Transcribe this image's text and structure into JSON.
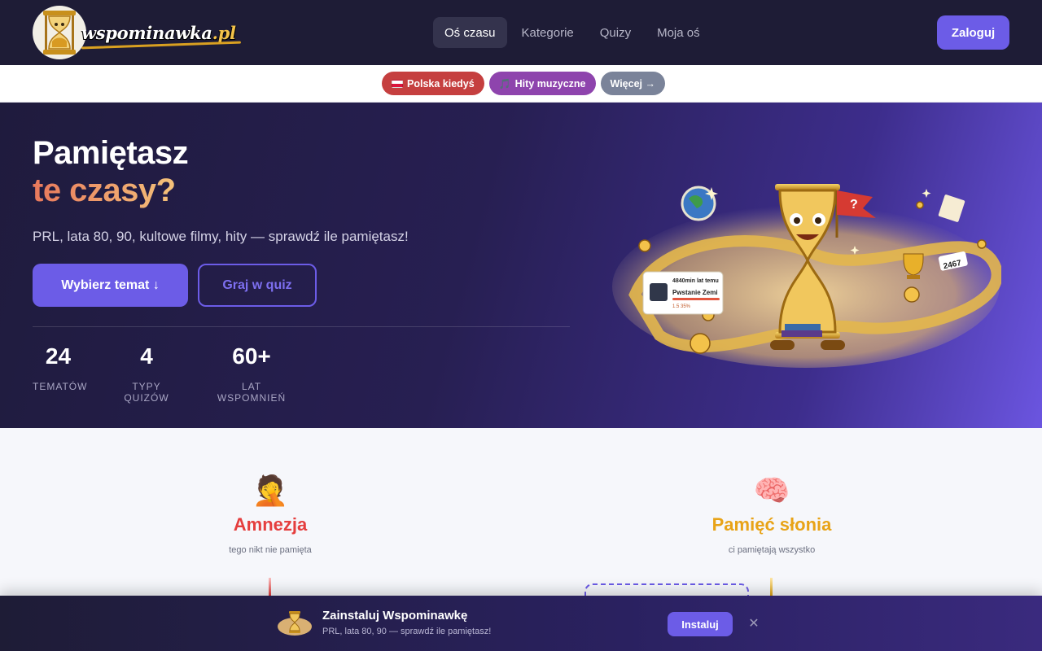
{
  "brand": {
    "name_main": "wspominawka",
    "name_tld": ".pl"
  },
  "nav": {
    "items": [
      {
        "label": "Oś czasu",
        "active": true
      },
      {
        "label": "Kategorie",
        "active": false
      },
      {
        "label": "Quizy",
        "active": false
      },
      {
        "label": "Moja oś",
        "active": false
      }
    ],
    "login_label": "Zaloguj"
  },
  "chips": [
    {
      "label": "Polska kiedyś",
      "icon": "poland-flag-icon",
      "color": "#c53f3f"
    },
    {
      "label": "Hity muzyczne",
      "icon": "music-note-icon",
      "color": "#8e44ad"
    },
    {
      "label": "Więcej →",
      "icon": "",
      "color": "#7a8399"
    }
  ],
  "hero": {
    "title_line1": "Pamiętasz",
    "title_line2": "te czasy?",
    "subtitle": "PRL, lata 80, 90, kultowe filmy, hity — sprawdź ile pamiętasz!",
    "primary_button": "Wybierz temat ↓",
    "secondary_button": "Graj w quiz",
    "stats": [
      {
        "value": "24",
        "label": "TEMATÓW"
      },
      {
        "value": "4",
        "label": "TYPY QUIZÓW"
      },
      {
        "value": "60+",
        "label": "LAT WSPOMNIEŃ"
      }
    ],
    "illustration": {
      "card_time": "4840min lat temu",
      "card_title": "Pwstanie Zemi",
      "card_meta": "1.5  35%",
      "counter": "2467",
      "flag_symbol": "?"
    }
  },
  "sections": [
    {
      "emoji": "🤦",
      "title": "Amnezja",
      "subtitle": "tego nikt nie pamięta",
      "color": "#e53e3e"
    },
    {
      "emoji": "🧠",
      "title": "Pamięć słonia",
      "subtitle": "ci pamiętają wszystko",
      "color": "#e8a317"
    }
  ],
  "install_banner": {
    "title": "Zainstaluj Wspominawkę",
    "subtitle": "PRL, lata 80, 90 — sprawdź ile pamiętasz!",
    "install_label": "Instaluj",
    "close_symbol": "✕"
  },
  "colors": {
    "accent": "#6c5ce7",
    "header_bg": "#1e1c36"
  }
}
